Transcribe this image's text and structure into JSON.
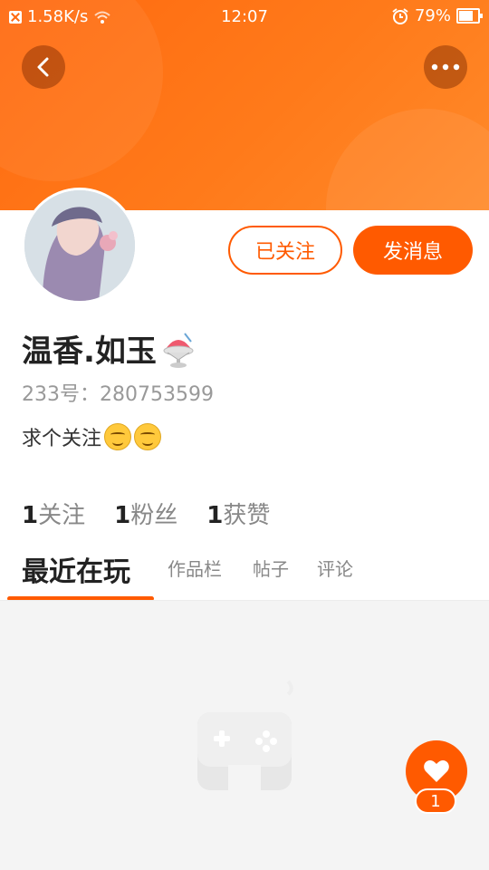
{
  "status_bar": {
    "net_speed": "1.58K/s",
    "time": "12:07",
    "battery": "79%"
  },
  "profile": {
    "name": "温香.如玉",
    "uid": "233号：280753599",
    "bio": "求个关注",
    "follow_btn": "已关注",
    "message_btn": "发消息"
  },
  "stats": [
    {
      "num": "1",
      "label": "关注"
    },
    {
      "num": "1",
      "label": "粉丝"
    },
    {
      "num": "1",
      "label": "获赞"
    }
  ],
  "tabs": [
    "最近在玩",
    "作品栏",
    "帖子",
    "评论"
  ],
  "fab": {
    "count": "1",
    "icon": "heart-icon"
  },
  "icons": {
    "back": "back-icon",
    "more": "more-icon",
    "empty": "gamepad-icon"
  },
  "colors": {
    "accent": "#ff5a00"
  }
}
